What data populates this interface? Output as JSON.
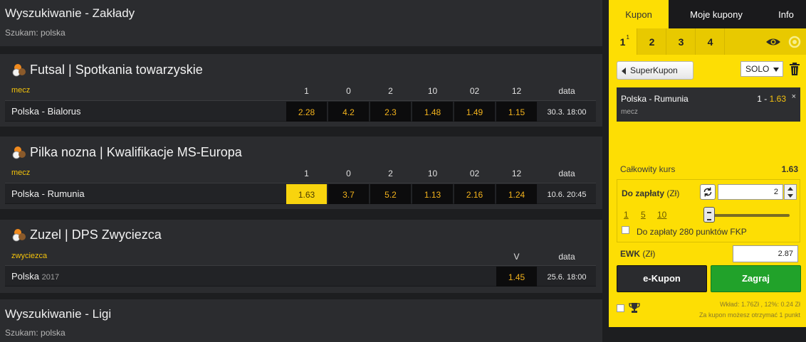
{
  "search_bets": {
    "title": "Wyszukiwanie - Zakłady",
    "query": "Szukam: polska"
  },
  "sections": [
    {
      "title": "Futsal | Spotkania towarzyskie",
      "market_label": "mecz",
      "columns": [
        "1",
        "0",
        "2",
        "10",
        "02",
        "12",
        "data"
      ],
      "rows": [
        {
          "name": "Polska - Bialorus",
          "odds": [
            "2.28",
            "4.2",
            "2.3",
            "1.48",
            "1.49",
            "1.15"
          ],
          "date": "30.3. 18:00"
        }
      ]
    },
    {
      "title": "Pilka nozna | Kwalifikacje MS-Europa",
      "market_label": "mecz",
      "columns": [
        "1",
        "0",
        "2",
        "10",
        "02",
        "12",
        "data"
      ],
      "rows": [
        {
          "name": "Polska - Rumunia",
          "odds": [
            "1.63",
            "3.7",
            "5.2",
            "1.13",
            "2.16",
            "1.24"
          ],
          "date": "10.6. 20:45",
          "selected_index": 0
        }
      ]
    },
    {
      "title": "Zuzel | DPS Zwyciezca",
      "market_label": "zwyciezca",
      "columns": [
        "V",
        "data"
      ],
      "rows": [
        {
          "name": "Polska",
          "year": "2017",
          "odds": [
            "1.45"
          ],
          "date": "25.6. 18:00"
        }
      ]
    }
  ],
  "search_leagues": {
    "title": "Wyszukiwanie - Ligi",
    "query": "Szukam: polska"
  },
  "coupon": {
    "tabs": [
      "Kupon",
      "Moje kupony",
      "Info"
    ],
    "active_tab": 0,
    "number_tabs": [
      "1",
      "2",
      "3",
      "4"
    ],
    "number_tab_badge": "1",
    "active_number_tab": 0,
    "superkupon_label": "SuperKupon",
    "mode_select": "SOLO",
    "bet": {
      "match": "Polska - Rumunia",
      "pick": "1",
      "separator": "-",
      "odd": "1.63",
      "market": "mecz",
      "close": "×"
    },
    "total_odds_label": "Całkowity kurs",
    "total_odds_value": "1.63",
    "stake_label": "Do zapłaty",
    "stake_unit": "(Zł)",
    "stake_value": "2",
    "quick_amounts": [
      "1",
      "5",
      "10"
    ],
    "fkp_label": "Do zapłaty 280 punktów FKP",
    "ewk_label": "EWK",
    "ewk_unit": "(Zł)",
    "ewk_value": "2.87",
    "ekupon_label": "e-Kupon",
    "play_label": "Zagraj",
    "footer_line1": "Wkład: 1.76Zł , 12%: 0.24 Zł",
    "footer_line2": "Za kupon możesz otrzymać 1 punkt",
    "colors": {
      "accent": "#fdde04",
      "play": "#21a22a",
      "odd_text": "#f2b21c"
    }
  }
}
